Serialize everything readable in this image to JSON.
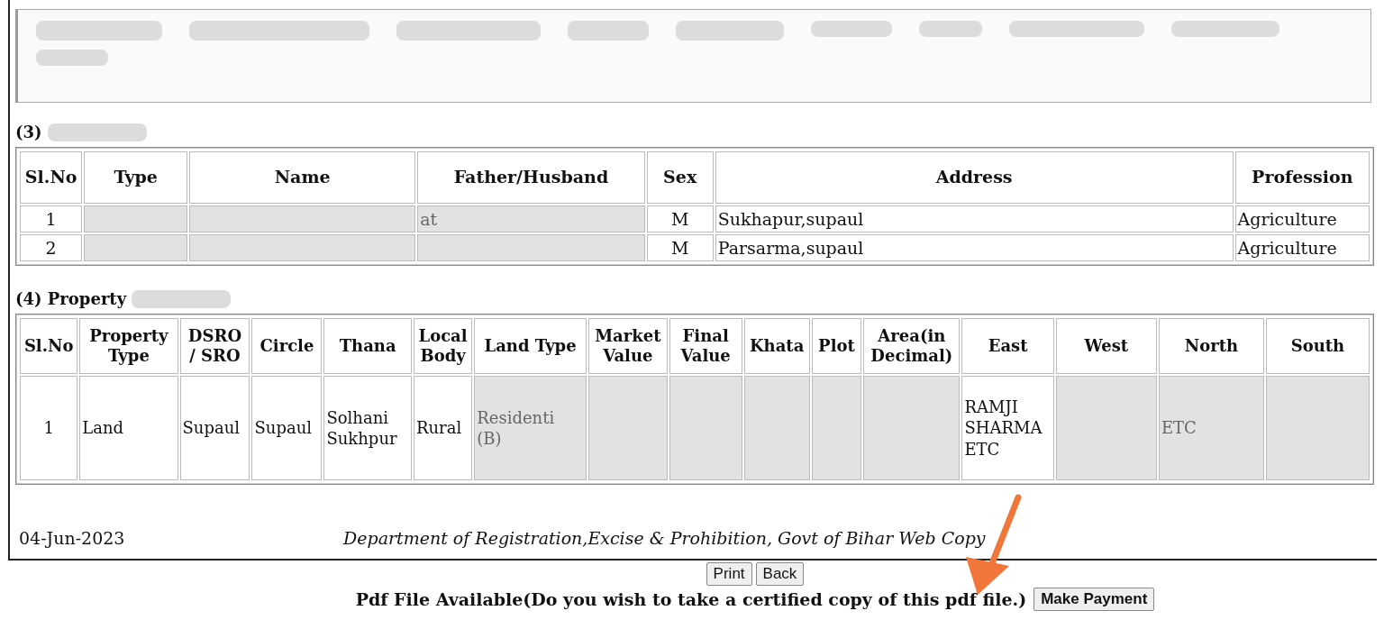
{
  "top_panel": {
    "redacted": true
  },
  "party_section": {
    "number": "(3)",
    "title_redacted": true,
    "columns": [
      "Sl.No",
      "Type",
      "Name",
      "Father/Husband",
      "Sex",
      "Address",
      "Profession"
    ],
    "rows": [
      {
        "cells": [
          {
            "text": "1"
          },
          {
            "redacted": true
          },
          {
            "redacted": true
          },
          {
            "text": "at",
            "redacted": true
          },
          {
            "text": "M"
          },
          {
            "text": "Sukhapur,supaul"
          },
          {
            "text": "Agriculture"
          }
        ]
      },
      {
        "cells": [
          {
            "text": "2"
          },
          {
            "redacted": true
          },
          {
            "redacted": true
          },
          {
            "redacted": true
          },
          {
            "text": "M"
          },
          {
            "text": "Parsarma,supaul"
          },
          {
            "text": "Agriculture"
          }
        ]
      }
    ]
  },
  "property_section": {
    "number": "(4) Property",
    "title_redacted": true,
    "columns": [
      "Sl.No",
      "Property Type",
      "DSRO / SRO",
      "Circle",
      "Thana",
      "Local Body",
      "Land Type",
      "Market Value",
      "Final Value",
      "Khata",
      "Plot",
      "Area(in Decimal)",
      "East",
      "West",
      "North",
      "South"
    ],
    "rows": [
      {
        "cells": [
          {
            "text": "1"
          },
          {
            "text": "Land"
          },
          {
            "text": "Supaul"
          },
          {
            "text": "Supaul"
          },
          {
            "text": "Solhani Sukhpur"
          },
          {
            "text": "Rural"
          },
          {
            "text": "Residenti (B)",
            "redacted": true
          },
          {
            "redacted": true
          },
          {
            "redacted": true
          },
          {
            "redacted": true
          },
          {
            "redacted": true
          },
          {
            "redacted": true
          },
          {
            "text": "RAMJI SHARMA ETC"
          },
          {
            "redacted": true
          },
          {
            "text": "ETC",
            "redacted": true
          },
          {
            "redacted": true
          }
        ]
      }
    ]
  },
  "footer": {
    "date": "04-Jun-2023",
    "department": "Department of Registration,Excise & Prohibition, Govt of Bihar Web Copy"
  },
  "buttons": [
    "Print",
    "Back"
  ],
  "pdf_notice": {
    "text": "Pdf File Available(Do you wish to take a certified copy of this pdf file.)",
    "button": "Make Payment"
  },
  "annotation": {
    "kind": "arrow",
    "color": "#f0763a"
  }
}
